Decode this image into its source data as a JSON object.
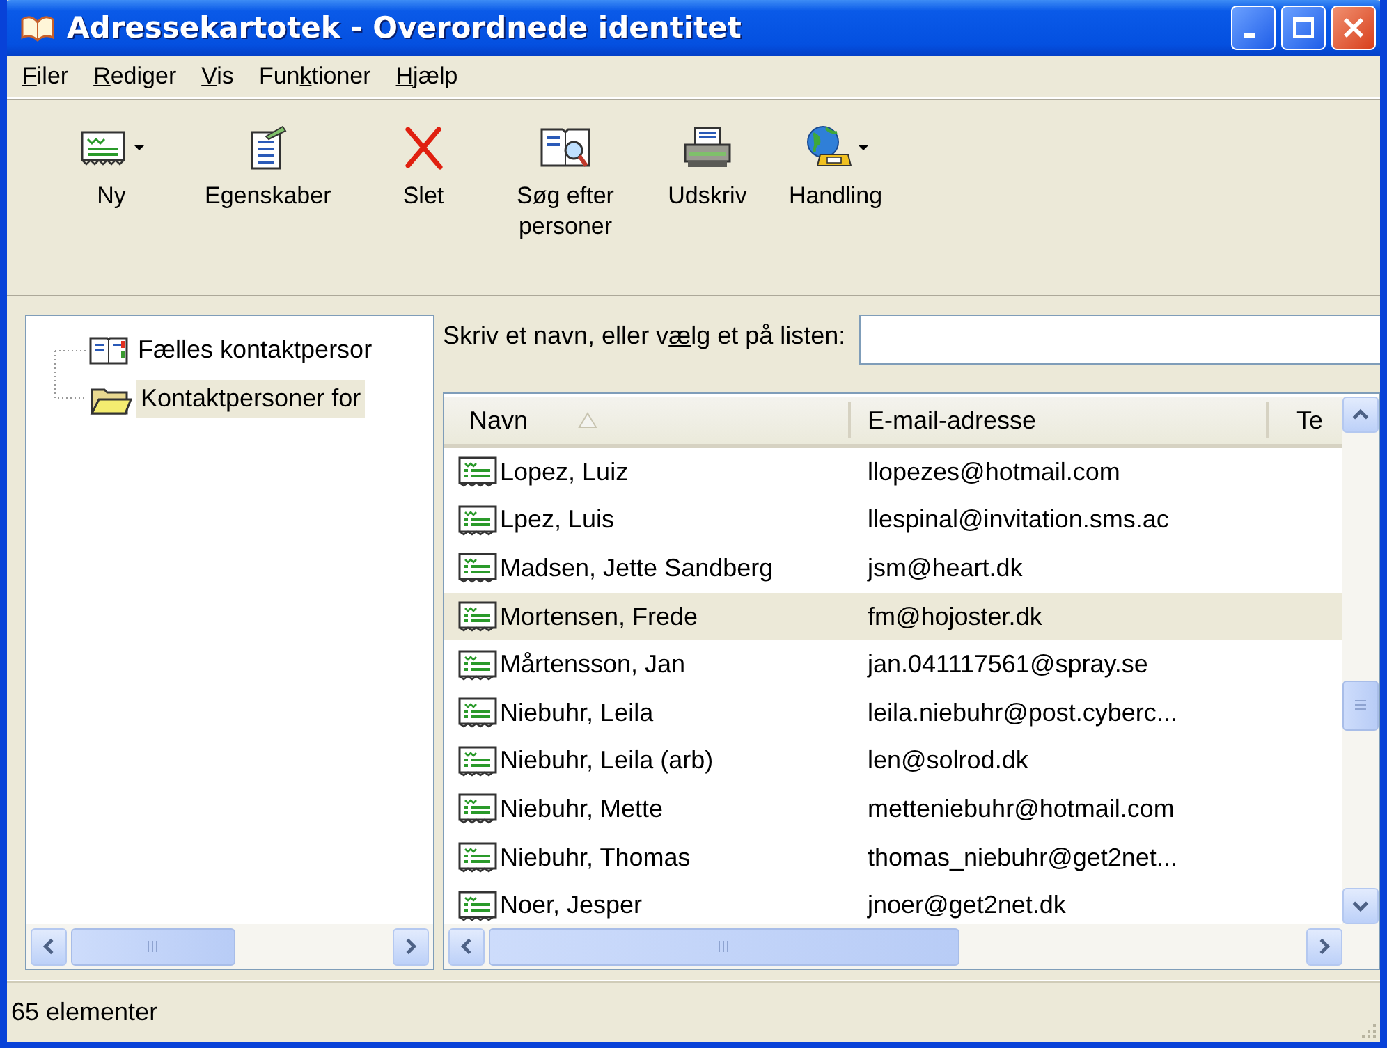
{
  "window": {
    "title": "Adressekartotek - Overordnede identitet"
  },
  "menu": [
    {
      "mnemonic": "F",
      "after": "iler"
    },
    {
      "mnemonic": "R",
      "after": "ediger"
    },
    {
      "mnemonic": "V",
      "after": "is"
    },
    {
      "before": "Fun",
      "mnemonic": "k",
      "after": "tioner"
    },
    {
      "mnemonic": "H",
      "after": "jælp"
    }
  ],
  "toolbar": [
    {
      "label": "Ny",
      "kind": "card",
      "dropdown": true
    },
    {
      "label": "Egenskaber",
      "kind": "properties",
      "dropdown": false
    },
    {
      "label": "Slet",
      "kind": "delete",
      "dropdown": false
    },
    {
      "label": "Søg efter personer",
      "kind": "find",
      "dropdown": false
    },
    {
      "label": "Udskriv",
      "kind": "print",
      "dropdown": false
    },
    {
      "label": "Handling",
      "kind": "globe-phone",
      "dropdown": true
    }
  ],
  "tree": [
    {
      "label": "Fælles kontaktpersor",
      "kind": "book",
      "selected": false
    },
    {
      "label": "Kontaktpersoner for",
      "kind": "folder",
      "selected": true
    }
  ],
  "prompt": {
    "before": "Skriv et navn, eller v",
    "mnemonic": "æ",
    "after": "lg et på listen:"
  },
  "table": {
    "columns": [
      {
        "label": "Navn",
        "sorted": true
      },
      {
        "label": "E-mail-adresse",
        "sorted": false
      },
      {
        "label": "Te",
        "sorted": false
      }
    ],
    "rows": [
      {
        "name": "Lopez, Luiz",
        "email": "llopezes@hotmail.com",
        "selected": false
      },
      {
        "name": "Lpez, Luis",
        "email": "llespinal@invitation.sms.ac",
        "selected": false
      },
      {
        "name": "Madsen, Jette Sandberg",
        "email": "jsm@heart.dk",
        "selected": false
      },
      {
        "name": "Mortensen, Frede",
        "email": "fm@hojoster.dk",
        "selected": true
      },
      {
        "name": "Mårtensson, Jan",
        "email": "jan.041117561@spray.se",
        "selected": false
      },
      {
        "name": "Niebuhr, Leila",
        "email": "leila.niebuhr@post.cyberc...",
        "selected": false
      },
      {
        "name": "Niebuhr, Leila (arb)",
        "email": "len@solrod.dk",
        "selected": false
      },
      {
        "name": "Niebuhr, Mette",
        "email": "metteniebuhr@hotmail.com",
        "selected": false
      },
      {
        "name": "Niebuhr, Thomas",
        "email": "thomas_niebuhr@get2net...",
        "selected": false
      },
      {
        "name": "Noer, Jesper",
        "email": "jnoer@get2net.dk",
        "selected": false
      }
    ]
  },
  "status_bar": {
    "text": "65 elementer"
  }
}
